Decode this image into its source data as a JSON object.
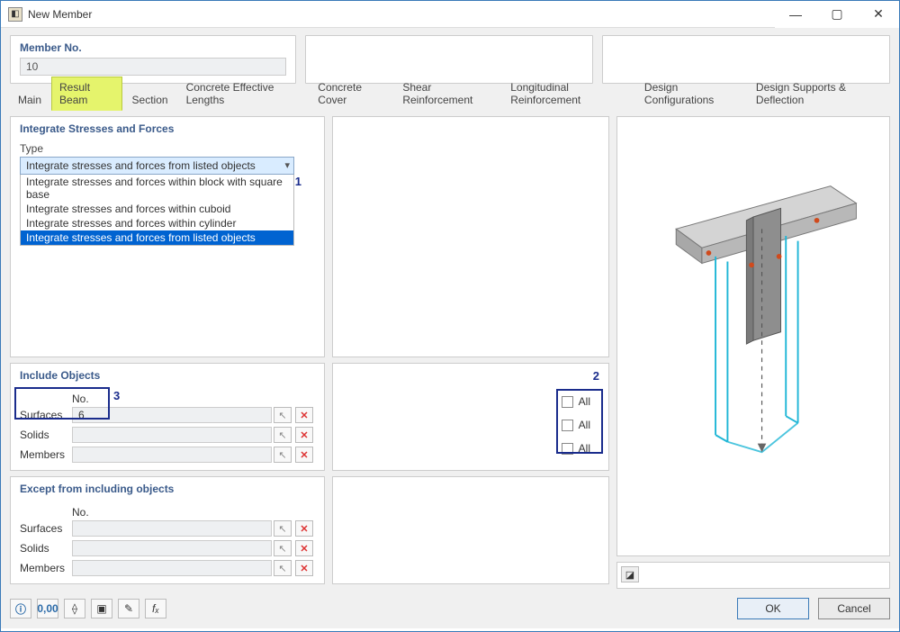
{
  "window": {
    "title": "New Member"
  },
  "member": {
    "label": "Member No.",
    "value": "10"
  },
  "tabs": [
    {
      "label": "Main"
    },
    {
      "label": "Result Beam"
    },
    {
      "label": "Section"
    },
    {
      "label": "Concrete Effective Lengths"
    },
    {
      "label": "Concrete Cover"
    },
    {
      "label": "Shear Reinforcement"
    },
    {
      "label": "Longitudinal Reinforcement"
    },
    {
      "label": "Design Configurations"
    },
    {
      "label": "Design Supports & Deflection"
    }
  ],
  "integrate": {
    "title": "Integrate Stresses and Forces",
    "type_label": "Type",
    "selected": "Integrate stresses and forces from listed objects",
    "options": [
      "Integrate stresses and forces within block with square base",
      "Integrate stresses and forces within cuboid",
      "Integrate stresses and forces within cylinder",
      "Integrate stresses and forces from listed objects"
    ]
  },
  "include": {
    "title": "Include Objects",
    "no_header": "No.",
    "rows": [
      {
        "label": "Surfaces",
        "value": "6"
      },
      {
        "label": "Solids",
        "value": ""
      },
      {
        "label": "Members",
        "value": ""
      }
    ],
    "all_label": "All"
  },
  "except": {
    "title": "Except from including objects",
    "no_header": "No.",
    "rows": [
      {
        "label": "Surfaces",
        "value": ""
      },
      {
        "label": "Solids",
        "value": ""
      },
      {
        "label": "Members",
        "value": ""
      }
    ]
  },
  "buttons": {
    "ok": "OK",
    "cancel": "Cancel"
  },
  "annotations": {
    "a1": "1",
    "a2": "2",
    "a3": "3"
  }
}
